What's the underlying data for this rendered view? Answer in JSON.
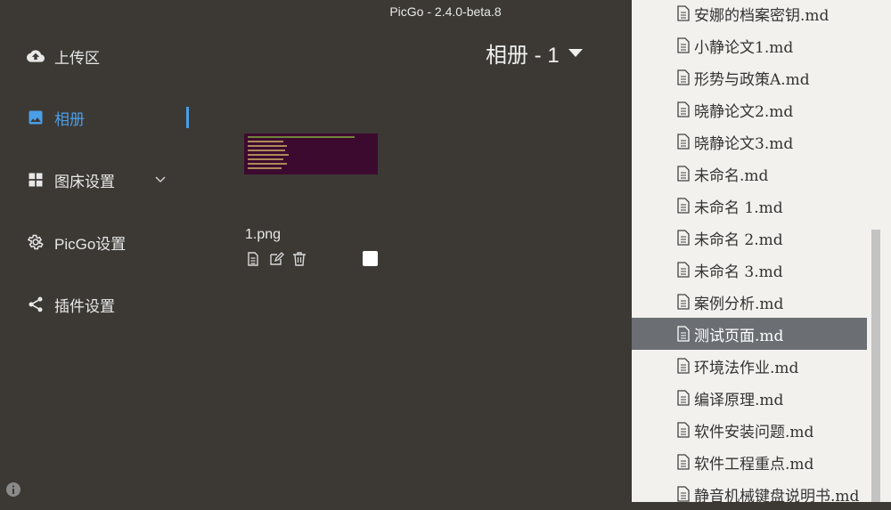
{
  "window": {
    "title": "PicGo - 2.4.0-beta.8"
  },
  "sidebar": {
    "items": [
      {
        "label": "上传区",
        "icon": "cloud-upload-icon"
      },
      {
        "label": "相册",
        "icon": "image-icon",
        "active": true
      },
      {
        "label": "图床设置",
        "icon": "grid-icon"
      },
      {
        "label": "PicGo设置",
        "icon": "gear-icon"
      },
      {
        "label": "插件设置",
        "icon": "share-icon"
      }
    ]
  },
  "gallery": {
    "title": "相册 - 1",
    "items": [
      {
        "name": "1.png",
        "checked": false
      }
    ]
  },
  "file_panel": {
    "items": [
      "安娜的档案密钥.md",
      "小静论文1.md",
      "形势与政策A.md",
      "晓静论文2.md",
      "晓静论文3.md",
      "未命名.md",
      "未命名 1.md",
      "未命名 2.md",
      "未命名 3.md",
      "案例分析.md",
      "测试页面.md",
      "环境法作业.md",
      "编译原理.md",
      "软件安装问题.md",
      "软件工程重点.md",
      "静音机械键盘说明书.md"
    ],
    "selected_index": 10
  },
  "colors": {
    "accent": "#4a9ee8",
    "background": "#3c3935",
    "selected_row": "#6b6f73"
  }
}
